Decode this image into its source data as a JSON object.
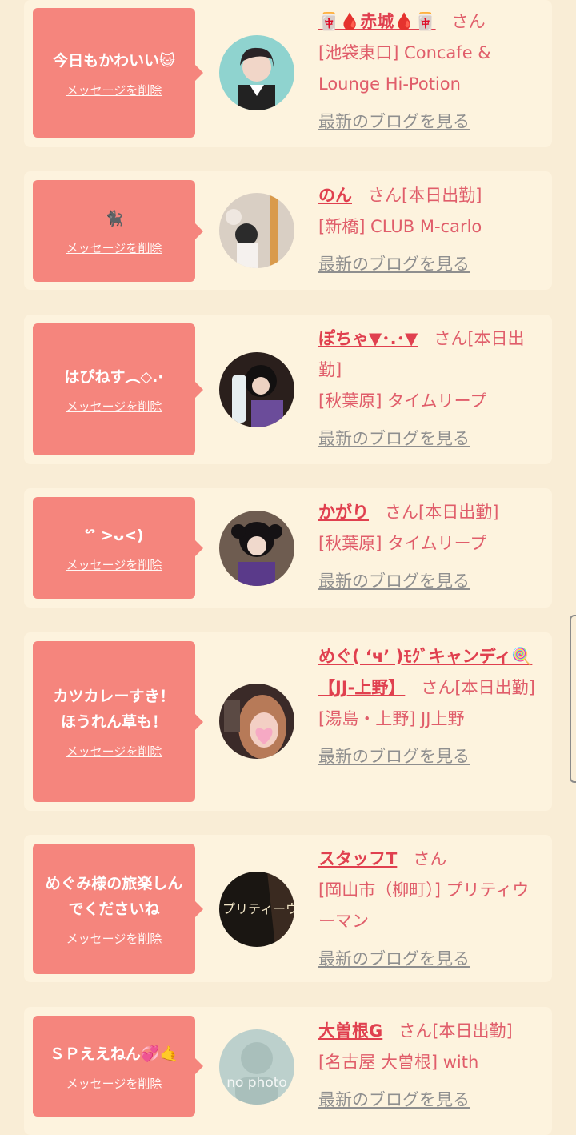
{
  "delete_label": "メッセージを削除",
  "blog_label": "最新のブログを見る",
  "san_label": "さん",
  "colors": {
    "background": "#f9edd6",
    "card": "#fdf3de",
    "bubble": "#f5857d",
    "name": "#e0404f",
    "link": "#8f8f8f"
  },
  "items": [
    {
      "message": "今日もかわいい😺",
      "name": "🀄🩸赤城🩸🀄",
      "suffix": "",
      "shop": "[池袋東口] Concafe & Lounge Hi-Potion"
    },
    {
      "message": "🐈‍⬛",
      "name": "のん",
      "suffix": "[本日出勤]",
      "shop": "[新橋] CLUB M-carlo"
    },
    {
      "message": "はぴねす︵◇.·",
      "name": "ぽちゃ▼･.･▼",
      "suffix": "[本日出勤]",
      "shop": "[秋葉原] タイムリープ"
    },
    {
      "message": "ᔥ >ᴗ<)",
      "name": "かがり",
      "suffix": "[本日出勤]",
      "shop": "[秋葉原] タイムリープ"
    },
    {
      "message": "カツカレーすき！ほうれん草も！",
      "name": "めぐ( ‘ч’ )ﾓｸﾞキャンディ🍭【JJ-上野】",
      "suffix": "[本日出勤]",
      "shop": "[湯島・上野] JJ上野"
    },
    {
      "message": "めぐみ様の旅楽しんでくださいね",
      "name": "スタッフT",
      "suffix": "",
      "shop": "[岡山市（柳町）] プリティウーマン"
    },
    {
      "message": "ＳＰええねん💞🤙",
      "name": "大曽根G",
      "suffix": "[本日出勤]",
      "shop": "[名古屋 大曽根] with"
    }
  ],
  "avatars": [
    {
      "label": ""
    },
    {
      "label": ""
    },
    {
      "label": ""
    },
    {
      "label": ""
    },
    {
      "label": ""
    },
    {
      "label": "プリティーウーマ"
    },
    {
      "label": "no photo"
    }
  ]
}
